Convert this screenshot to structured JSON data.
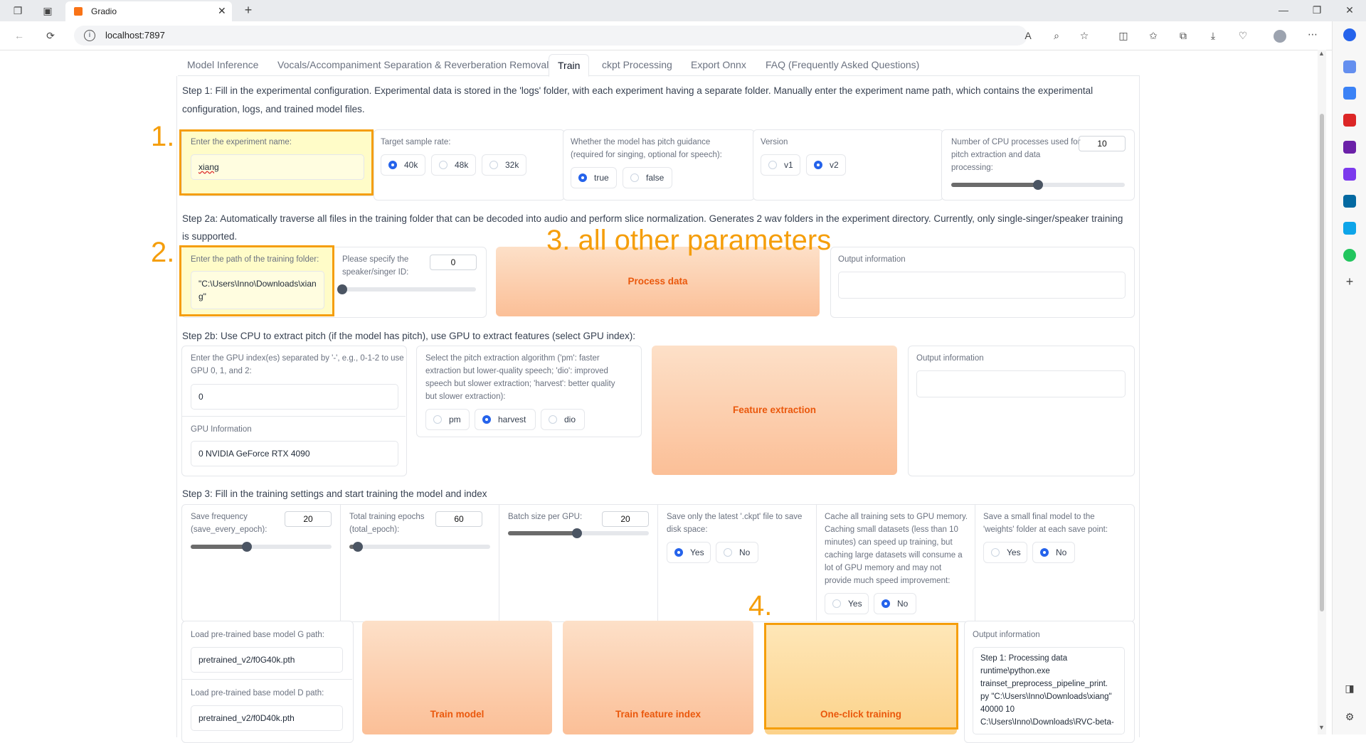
{
  "browser": {
    "tab_title": "Gradio",
    "url": "localhost:7897"
  },
  "tabs": [
    "Model Inference",
    "Vocals/Accompaniment Separation & Reverberation Removal",
    "Train",
    "ckpt Processing",
    "Export Onnx",
    "FAQ (Frequently Asked Questions)"
  ],
  "step1": {
    "text_line1": "Step 1: Fill in the experimental configuration. Experimental data is stored in the 'logs' folder, with each experiment having a separate folder. Manually enter the experiment name path, which contains the experimental",
    "text_line2": "configuration, logs, and trained model files.",
    "exp_name_label": "Enter the experiment name:",
    "exp_name_value": "xiang",
    "sample_rate_label": "Target sample rate:",
    "sample_rates": [
      "40k",
      "48k",
      "32k"
    ],
    "sample_rate_selected": "40k",
    "pitch_label_line1": "Whether the model has pitch guidance",
    "pitch_label_line2": "(required for singing, optional for speech):",
    "pitch_true": "true",
    "pitch_false": "false",
    "version_label": "Version",
    "version_v1": "v1",
    "version_v2": "v2",
    "cpu_label_line1": "Number of CPU processes used for",
    "cpu_label_line2": "pitch extraction and data",
    "cpu_label_line3": "processing:",
    "cpu_value": "10",
    "cpu_fraction": 0.5
  },
  "step2a": {
    "text_line1": "Step 2a: Automatically traverse all files in the training folder that can be decoded into audio and perform slice normalization. Generates 2 wav folders in the experiment directory. Currently, only single-singer/speaker training",
    "text_line2": "is supported.",
    "folder_label": "Enter the path of the training folder:",
    "folder_value_line1": "\"C:\\Users\\Inno\\Downloads\\xian",
    "folder_value_line2": "g\"",
    "speaker_label_line1": "Please specify the",
    "speaker_label_line2": "speaker/singer ID:",
    "speaker_value": "0",
    "speaker_fraction": 0.0,
    "process_button": "Process data",
    "output_label": "Output information"
  },
  "step2b": {
    "text": "Step 2b: Use CPU to extract pitch (if the model has pitch), use GPU to extract features (select GPU index):",
    "gpu_label_line1": "Enter the GPU index(es) separated by '-', e.g., 0-1-2 to use",
    "gpu_label_line2": "GPU 0, 1, and 2:",
    "gpu_value": "0",
    "gpu_info_label": "GPU Information",
    "gpu_info_value": "0 NVIDIA GeForce RTX 4090",
    "algo_label_line1": "Select the pitch extraction algorithm ('pm': faster",
    "algo_label_line2": "extraction but lower-quality speech; 'dio': improved",
    "algo_label_line3": "speech but slower extraction; 'harvest': better quality",
    "algo_label_line4": "but slower extraction):",
    "algo_pm": "pm",
    "algo_harvest": "harvest",
    "algo_dio": "dio",
    "feature_button": "Feature extraction",
    "output_label": "Output information"
  },
  "step3": {
    "text": "Step 3: Fill in the training settings and start training the model and index",
    "save_freq_label_line1": "Save frequency",
    "save_freq_label_line2": "(save_every_epoch):",
    "save_freq_value": "20",
    "save_freq_fraction": 0.4,
    "epochs_label_line1": "Total training epochs",
    "epochs_label_line2": "(total_epoch):",
    "epochs_value": "60",
    "epochs_fraction": 0.06,
    "batch_label": "Batch size per GPU:",
    "batch_value": "20",
    "batch_fraction": 0.49,
    "latest_label_line1": "Save only the latest '.ckpt' file to save",
    "latest_label_line2": "disk space:",
    "cache_label_line1": "Cache all training sets to GPU memory.",
    "cache_label_line2": "Caching small datasets (less than 10",
    "cache_label_line3": "minutes) can speed up training, but",
    "cache_label_line4": "caching large datasets will consume a",
    "cache_label_line5": "lot of GPU memory and may not",
    "cache_label_line6": "provide much speed improvement:",
    "small_label_line1": "Save a small final model to the",
    "small_label_line2": "'weights' folder at each save point:",
    "yes": "Yes",
    "no": "No",
    "g_path_label": "Load pre-trained base model G path:",
    "g_path_value": "pretrained_v2/f0G40k.pth",
    "d_path_label": "Load pre-trained base model D path:",
    "d_path_value": "pretrained_v2/f0D40k.pth",
    "train_model_button": "Train model",
    "train_index_button": "Train feature index",
    "one_click_button": "One-click training",
    "output_label": "Output information",
    "output_lines": [
      "Step 1: Processing data",
      "runtime\\python.exe",
      "trainset_preprocess_pipeline_print.",
      "py \"C:\\Users\\Inno\\Downloads\\xiang\"",
      "40000 10",
      "C:\\Users\\Inno\\Downloads\\RVC-beta-"
    ]
  },
  "annotations": {
    "a1": "1.",
    "a2": "2.",
    "a3": "3. all other parameters",
    "a4": "4."
  }
}
